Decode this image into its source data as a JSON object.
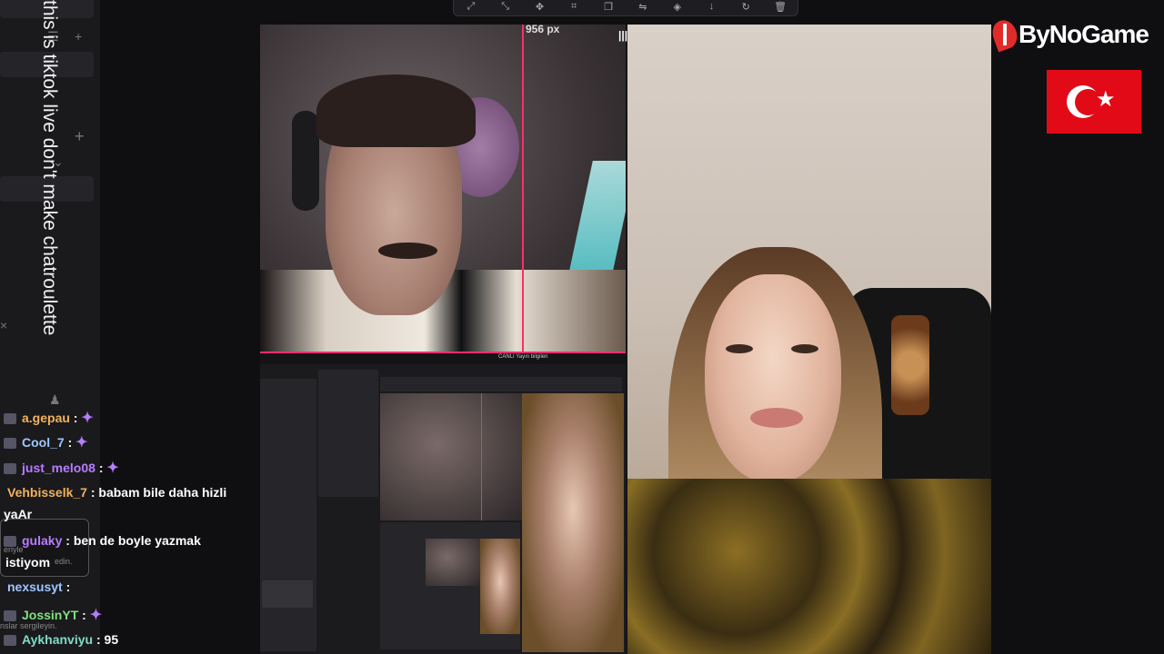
{
  "overlay_text": "this is tiktok live don't make chatroulette",
  "brand": {
    "name": "ByNoGame"
  },
  "guide": {
    "px_label": "956 px"
  },
  "toolbar": {
    "buttons": [
      "fit-icon",
      "expand-icon",
      "align-center-icon",
      "crop-icon",
      "copy-icon",
      "flip-icon",
      "layers-icon",
      "download-icon",
      "rotate-icon",
      "delete-icon"
    ]
  },
  "nested_window": {
    "title": "CANLI Yayın bilgileri"
  },
  "chat": {
    "messages": [
      {
        "user": "a.gepau",
        "message": "",
        "user_color": "#f2b25c",
        "emote": true
      },
      {
        "user": "Cool_7",
        "message": "",
        "user_color": "#9fc6ff",
        "emote": true
      },
      {
        "user": "just_melo08",
        "message": "",
        "user_color": "#b77dff",
        "emote": true
      },
      {
        "user": "Vehbisselk_7",
        "message": "babam bile daha hizli",
        "user_color": "#f2b25c",
        "emote": false
      },
      {
        "user": "",
        "message": "yaAr",
        "user_color": "#ffffff",
        "emote": false
      },
      {
        "user": "gulaky",
        "message": "ben de boyle yazmak",
        "user_color": "#b77dff",
        "emote": false
      },
      {
        "user": "",
        "message": "istiyom",
        "user_color": "#ffffff",
        "emote": false
      },
      {
        "user": "nexsusyt",
        "message": "",
        "user_color": "#9fc6ff",
        "emote": false
      },
      {
        "user": "JossinYT",
        "message": "",
        "user_color": "#7fe07f",
        "emote": true
      },
      {
        "user": "Aykhanviyu",
        "message": "95",
        "user_color": "#7fdcc6",
        "emote": false
      }
    ],
    "separator": ":",
    "faint_lines": [
      "eriyle",
      "edin.",
      "nslar sergileyin."
    ]
  },
  "colors": {
    "guide": "#ff2d6a",
    "flag_red": "#e30a17",
    "brand_red": "#e12b2b"
  }
}
